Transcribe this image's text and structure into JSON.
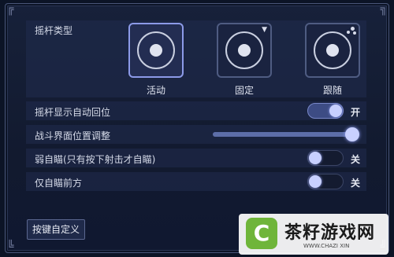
{
  "joystick": {
    "section_label": "摇杆类型",
    "options": [
      {
        "label": "活动",
        "selected": true,
        "badge": ""
      },
      {
        "label": "固定",
        "selected": false,
        "badge": "pin-icon"
      },
      {
        "label": "跟随",
        "selected": false,
        "badge": "dots-icon"
      }
    ]
  },
  "settings": {
    "auto_return": {
      "label": "摇杆显示自动回位",
      "state": "on",
      "state_label": "开"
    },
    "ui_position": {
      "label": "战斗界面位置调整",
      "value_fraction": 1.0
    },
    "weak_aim": {
      "label": "弱自瞄(只有按下射击才自瞄)",
      "state": "off",
      "state_label": "关"
    },
    "front_aim": {
      "label": "仅自瞄前方",
      "state": "off",
      "state_label": "关"
    }
  },
  "footer": {
    "custom_keys_label": "按键自定义"
  },
  "watermark": {
    "logo_letter": "C",
    "title": "茶籽游戏网",
    "url": "WWW.CHAZI XIN"
  },
  "colors": {
    "accent": "#7887c8",
    "knob": "#c8d0ff",
    "background": "#0c1426",
    "watermark_green": "#6fb53a"
  }
}
